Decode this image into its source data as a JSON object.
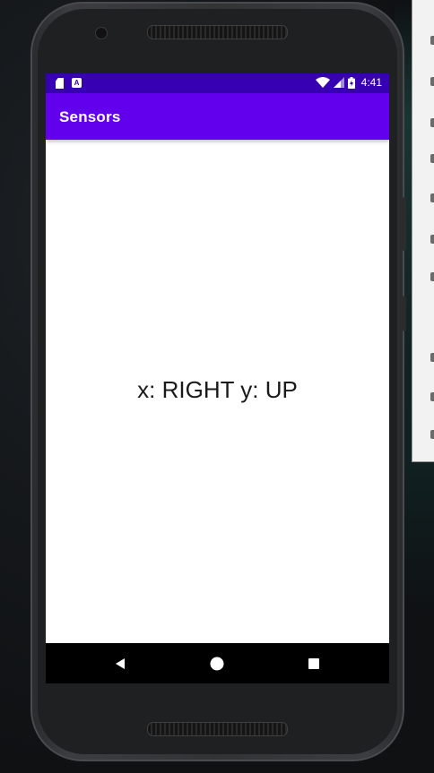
{
  "status_bar": {
    "time": "4:41",
    "icons": [
      "sd-card-icon",
      "a-notification-icon",
      "wifi-icon",
      "cell-signal-icon",
      "battery-icon"
    ],
    "a_icon_letter": "A"
  },
  "app_bar": {
    "title": "Sensors"
  },
  "main": {
    "sensor_text": "x: RIGHT y: UP"
  },
  "nav_bar": {
    "buttons": [
      "back-icon",
      "home-icon",
      "recents-icon"
    ]
  },
  "colors": {
    "status_bar": "#3700b3",
    "app_bar": "#6200ee",
    "screen_bg": "#ffffff",
    "nav_bar": "#000000"
  }
}
